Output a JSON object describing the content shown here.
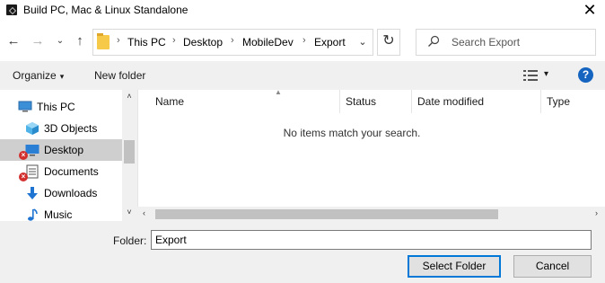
{
  "window": {
    "title": "Build PC, Mac & Linux Standalone",
    "close_glyph": "✕"
  },
  "nav": {
    "back_glyph": "←",
    "forward_glyph": "→",
    "recent_glyph": "⌄",
    "up_glyph": "↑",
    "breadcrumb": [
      "This PC",
      "Desktop",
      "MobileDev",
      "Export"
    ],
    "separator": "›",
    "dropdown_glyph": "⌄",
    "refresh_glyph": "↻"
  },
  "search": {
    "placeholder": "Search Export"
  },
  "toolbar": {
    "organize_label": "Organize",
    "organize_caret": "▾",
    "new_folder_label": "New folder",
    "view_caret": "▾",
    "help_label": "?"
  },
  "tree": {
    "items": [
      {
        "label": "This PC",
        "icon": "computer-icon"
      },
      {
        "label": "3D Objects",
        "icon": "cube-icon"
      },
      {
        "label": "Desktop",
        "icon": "desktop-icon",
        "selected": true,
        "error": true
      },
      {
        "label": "Documents",
        "icon": "document-icon",
        "error": true
      },
      {
        "label": "Downloads",
        "icon": "download-arrow-icon"
      },
      {
        "label": "Music",
        "icon": "music-note-icon"
      }
    ],
    "error_glyph": "×"
  },
  "list": {
    "columns": [
      "Name",
      "Status",
      "Date modified",
      "Type"
    ],
    "empty_message": "No items match your search."
  },
  "footer": {
    "folder_label": "Folder:",
    "folder_value": "Export",
    "primary_button": "Select Folder",
    "cancel_button": "Cancel"
  },
  "scroll": {
    "up": "˄",
    "down": "˅",
    "left": "‹",
    "right": "›"
  },
  "colors": {
    "accent": "#0078d7",
    "selection": "#cfcfcf",
    "folder": "#f7c948",
    "help": "#1565c0",
    "error": "#d32f2f"
  }
}
